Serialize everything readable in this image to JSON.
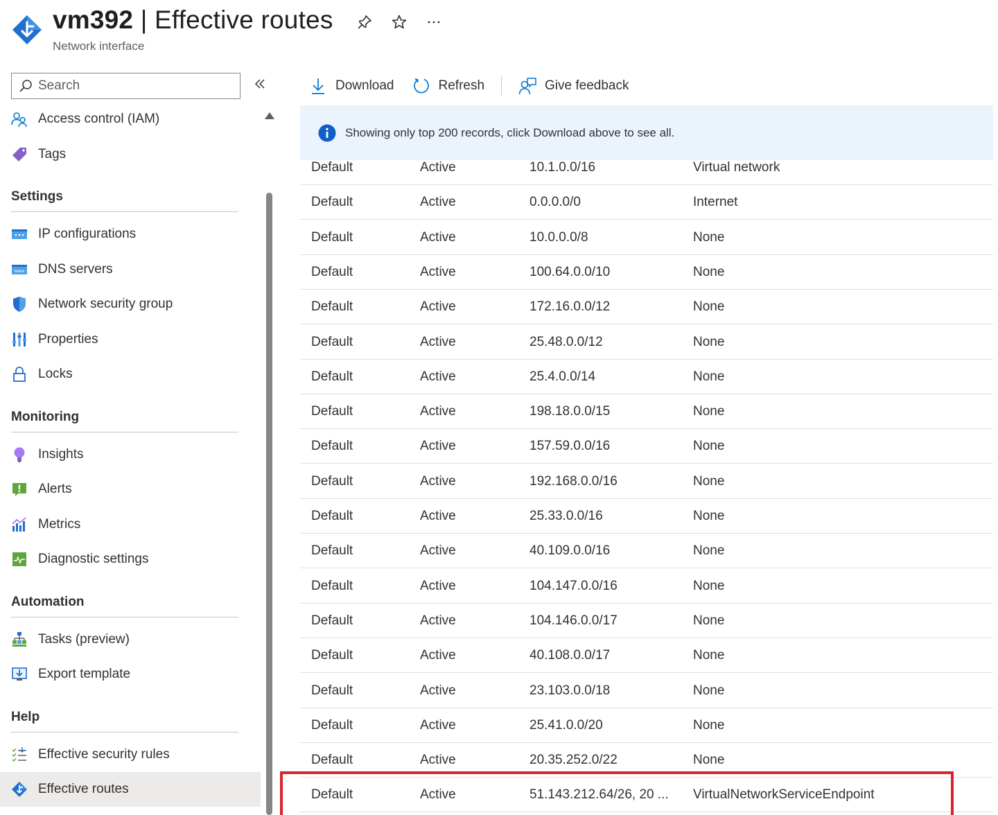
{
  "header": {
    "resource_name": "vm392",
    "separator": " | ",
    "page_name": "Effective routes",
    "subtitle": "Network interface",
    "actions": [
      "pin-icon",
      "star-icon",
      "more-icon"
    ]
  },
  "sidebar": {
    "search_placeholder": "Search",
    "items_top": [
      {
        "label": "Access control (IAM)",
        "icon": "iam-icon"
      },
      {
        "label": "Tags",
        "icon": "tag-icon"
      }
    ],
    "sections": [
      {
        "title": "Settings",
        "items": [
          {
            "label": "IP configurations",
            "icon": "ip-config-icon"
          },
          {
            "label": "DNS servers",
            "icon": "dns-icon"
          },
          {
            "label": "Network security group",
            "icon": "shield-icon"
          },
          {
            "label": "Properties",
            "icon": "properties-icon"
          },
          {
            "label": "Locks",
            "icon": "lock-icon"
          }
        ]
      },
      {
        "title": "Monitoring",
        "items": [
          {
            "label": "Insights",
            "icon": "insights-icon"
          },
          {
            "label": "Alerts",
            "icon": "alert-icon"
          },
          {
            "label": "Metrics",
            "icon": "metrics-icon"
          },
          {
            "label": "Diagnostic settings",
            "icon": "diagnostic-icon"
          }
        ]
      },
      {
        "title": "Automation",
        "items": [
          {
            "label": "Tasks (preview)",
            "icon": "tasks-icon"
          },
          {
            "label": "Export template",
            "icon": "export-icon"
          }
        ]
      },
      {
        "title": "Help",
        "items": [
          {
            "label": "Effective security rules",
            "icon": "security-rules-icon"
          },
          {
            "label": "Effective routes",
            "icon": "routes-icon",
            "active": true
          }
        ]
      }
    ]
  },
  "toolbar": {
    "download_label": "Download",
    "refresh_label": "Refresh",
    "feedback_label": "Give feedback"
  },
  "banner": {
    "text": "Showing only top 200 records, click Download above to see all."
  },
  "routes": [
    {
      "source": "Default",
      "state": "Active",
      "prefix": "10.1.0.0/16",
      "next_hop": "Virtual network"
    },
    {
      "source": "Default",
      "state": "Active",
      "prefix": "0.0.0.0/0",
      "next_hop": "Internet"
    },
    {
      "source": "Default",
      "state": "Active",
      "prefix": "10.0.0.0/8",
      "next_hop": "None"
    },
    {
      "source": "Default",
      "state": "Active",
      "prefix": "100.64.0.0/10",
      "next_hop": "None"
    },
    {
      "source": "Default",
      "state": "Active",
      "prefix": "172.16.0.0/12",
      "next_hop": "None"
    },
    {
      "source": "Default",
      "state": "Active",
      "prefix": "25.48.0.0/12",
      "next_hop": "None"
    },
    {
      "source": "Default",
      "state": "Active",
      "prefix": "25.4.0.0/14",
      "next_hop": "None"
    },
    {
      "source": "Default",
      "state": "Active",
      "prefix": "198.18.0.0/15",
      "next_hop": "None"
    },
    {
      "source": "Default",
      "state": "Active",
      "prefix": "157.59.0.0/16",
      "next_hop": "None"
    },
    {
      "source": "Default",
      "state": "Active",
      "prefix": "192.168.0.0/16",
      "next_hop": "None"
    },
    {
      "source": "Default",
      "state": "Active",
      "prefix": "25.33.0.0/16",
      "next_hop": "None"
    },
    {
      "source": "Default",
      "state": "Active",
      "prefix": "40.109.0.0/16",
      "next_hop": "None"
    },
    {
      "source": "Default",
      "state": "Active",
      "prefix": "104.147.0.0/16",
      "next_hop": "None"
    },
    {
      "source": "Default",
      "state": "Active",
      "prefix": "104.146.0.0/17",
      "next_hop": "None"
    },
    {
      "source": "Default",
      "state": "Active",
      "prefix": "40.108.0.0/17",
      "next_hop": "None"
    },
    {
      "source": "Default",
      "state": "Active",
      "prefix": "23.103.0.0/18",
      "next_hop": "None"
    },
    {
      "source": "Default",
      "state": "Active",
      "prefix": "25.41.0.0/20",
      "next_hop": "None"
    },
    {
      "source": "Default",
      "state": "Active",
      "prefix": "20.35.252.0/22",
      "next_hop": "None"
    },
    {
      "source": "Default",
      "state": "Active",
      "prefix": "51.143.212.64/26, 20 ...",
      "next_hop": "VirtualNetworkServiceEndpoint",
      "highlighted": true
    }
  ],
  "colors": {
    "accent": "#0078d4",
    "highlight": "#d9232e",
    "banner_bg": "#ebf3fc"
  }
}
